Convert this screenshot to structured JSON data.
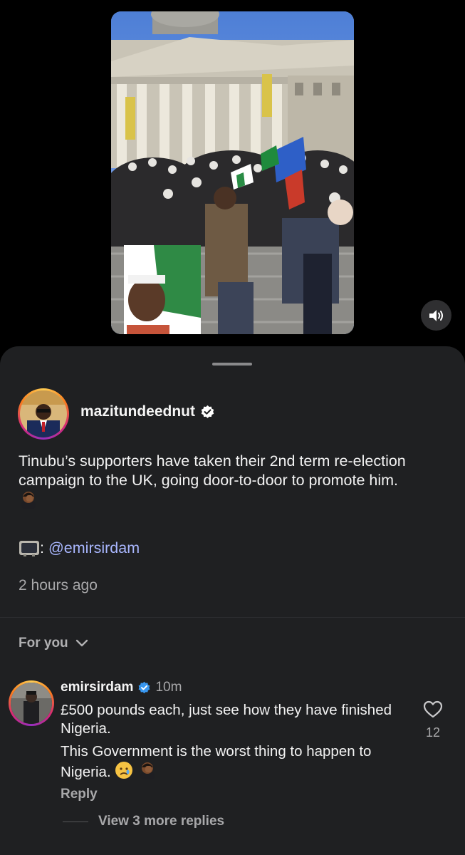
{
  "video": {
    "media_description": "video-thumbnail",
    "mute_icon": "speaker-icon"
  },
  "post": {
    "username": "mazitundeednut",
    "verified": true,
    "caption": "Tinubu’s supporters have taken their 2nd term re-election campaign to the UK, going door-to-door to promote him.",
    "caption_emoji": "person-facepalming-emoji",
    "credit_prefix": ":",
    "credit_emoji": "television-emoji",
    "credit_mention": "@emirsirdam",
    "time": "2 hours ago"
  },
  "sort": {
    "label": "For you",
    "icon": "chevron-down-icon"
  },
  "comment": {
    "username": "emirsirdam",
    "verified": true,
    "age": "10m",
    "line1": "£500 pounds each, just see how they have finished Nigeria.",
    "line2": "This Government is the worst thing to happen to Nigeria.",
    "like_count": "12",
    "reply_label": "Reply",
    "view_replies_label": "View 3 more replies"
  },
  "colors": {
    "background": "#000000",
    "sheet": "#1f2022",
    "mention": "#a9b7ff",
    "verified": "#3897f0",
    "muted_text": "#a8a8aa"
  }
}
